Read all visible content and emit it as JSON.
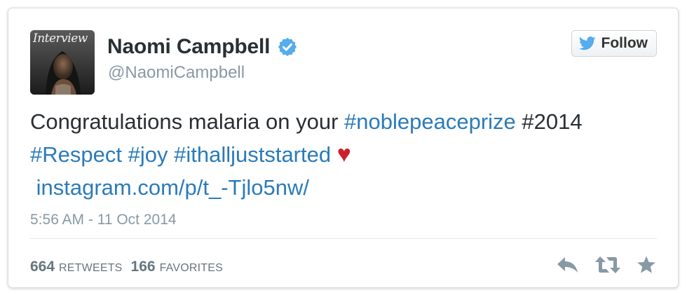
{
  "profile": {
    "display_name": "Naomi Campbell",
    "handle": "@NaomiCampbell",
    "avatar_text": "Interview"
  },
  "follow_button": {
    "label": "Follow"
  },
  "tweet": {
    "line1": {
      "text": "Congratulations malaria on your ",
      "hashtag1": "#noblepeaceprize",
      "text2": " #2014"
    },
    "line2": {
      "hashtag1": "#Respect",
      "hashtag2": "#joy",
      "hashtag3": "#ithalljuststarted",
      "emoji": "♥"
    },
    "line3": {
      "link": "instagram.com/p/t_-Tjlo5nw/"
    }
  },
  "timestamp": "5:56 AM - 11 Oct 2014",
  "stats": {
    "retweets_count": "664",
    "retweets_label": "Retweets",
    "favorites_count": "166",
    "favorites_label": "Favorites"
  },
  "colors": {
    "link": "#2b7bb9",
    "verified": "#55acee",
    "heart": "#cc1f2d",
    "muted": "#8899a6"
  },
  "icons": {
    "verified": "verified-badge-icon",
    "bird": "twitter-bird-icon",
    "reply": "reply-icon",
    "retweet": "retweet-icon",
    "favorite": "star-icon"
  }
}
